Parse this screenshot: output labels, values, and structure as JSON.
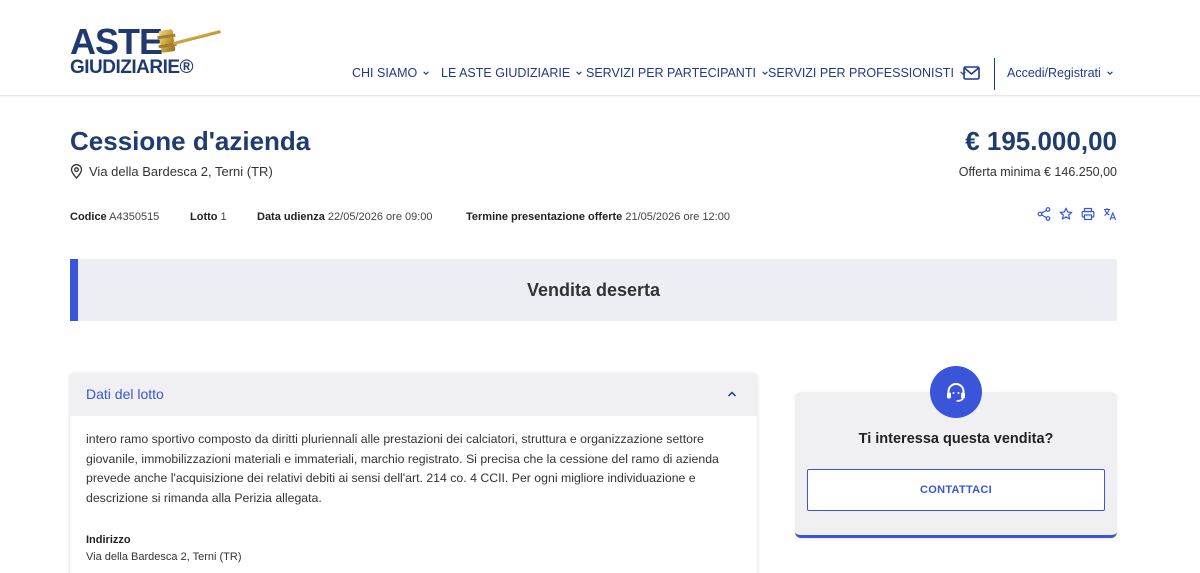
{
  "logo": {
    "line1": "ASTE",
    "line2": "GIUDIZIARIE®"
  },
  "nav": {
    "items": [
      {
        "label": "CHI SIAMO"
      },
      {
        "label": "LE ASTE GIUDIZIARIE"
      },
      {
        "label": "SERVIZI PER PARTECIPANTI"
      },
      {
        "label": "SERVIZI PER PROFESSIONISTI"
      }
    ],
    "login_label": "Accedi/Registrati",
    "mail_icon": "mail-icon"
  },
  "listing": {
    "title": "Cessione d'azienda",
    "address": "Via della Bardesca 2, Terni (TR)",
    "price": "€ 195.000,00",
    "min_offer": "Offerta minima € 146.250,00",
    "meta": {
      "codice_label": "Codice",
      "codice_value": "A4350515",
      "lotto_label": "Lotto",
      "lotto_value": "1",
      "udienza_label": "Data udienza",
      "udienza_value": "22/05/2026 ore 09:00",
      "termine_label": "Termine presentazione offerte",
      "termine_value": "21/05/2026 ore 12:00"
    },
    "actions": [
      "share-icon",
      "star-icon",
      "print-icon",
      "translate-icon"
    ]
  },
  "banner": {
    "text": "Vendita deserta"
  },
  "lot": {
    "header": "Dati del lotto",
    "description": "intero ramo sportivo composto da diritti pluriennali alle prestazioni dei calciatori, struttura e organizzazione settore giovanile, immobilizzazioni materiali e immateriali, marchio registrato. Si precisa che la cessione del ramo di azienda prevede anche l'acquisizione dei relativi debiti ai sensi dell'art. 214 co. 4 CCII. Per ogni migliore individuazione e descrizione si rimanda alla Perizia allegata.",
    "address_label": "Indirizzo",
    "address_value": "Via della Bardesca 2, Terni (TR)"
  },
  "contact": {
    "question": "Ti interessa questa vendita?",
    "button_label": "CONTATTACI",
    "icon": "headset-icon"
  },
  "colors": {
    "brand_dark": "#1e3d6e",
    "accent": "#3a55d9",
    "nav_text": "#1f3a8a",
    "banner_bg": "#eceef4"
  }
}
